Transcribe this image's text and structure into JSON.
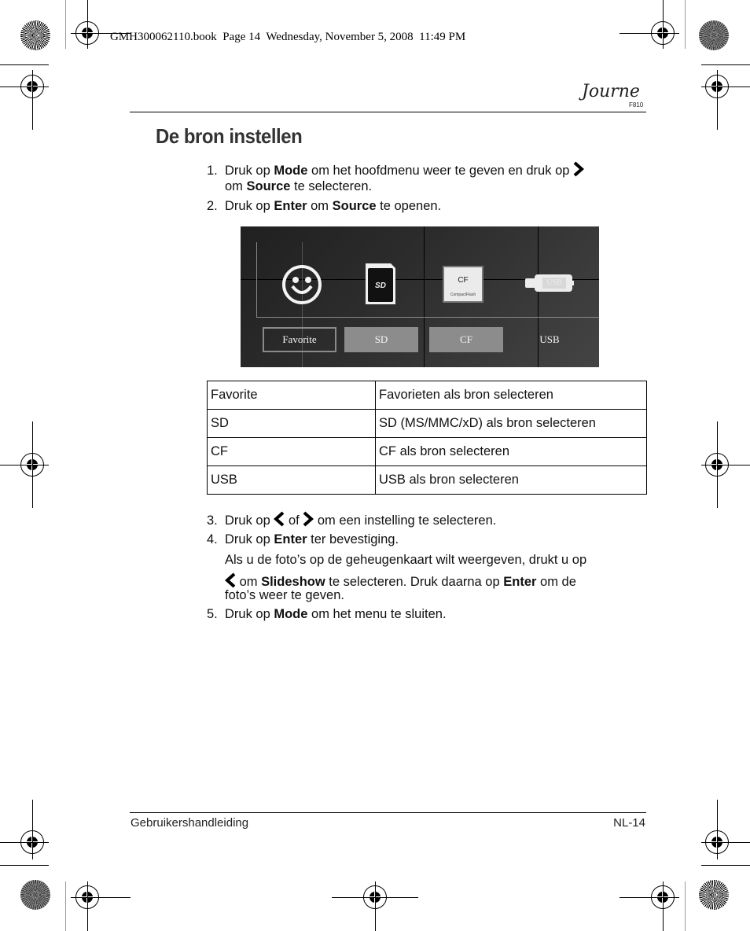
{
  "print_slug": "GMH300062110.book  Page 14  Wednesday, November 5, 2008  11:49 PM",
  "header": {
    "logo_text": "Journe",
    "model": "F810"
  },
  "title": "De bron instellen",
  "steps": [
    {
      "num": "1.",
      "parts": [
        "Druk op ",
        "Mode",
        " om het hoofdmenu weer te geven en druk op "
      ],
      "cont_parts": [
        "om ",
        "Source",
        " te selecteren."
      ]
    },
    {
      "num": "2.",
      "parts": [
        "Druk op ",
        "Enter",
        " om ",
        "Source",
        " te openen."
      ]
    },
    {
      "num": "3.",
      "parts": [
        "Druk op ",
        " of ",
        " om een instelling te selecteren."
      ]
    },
    {
      "num": "4.",
      "parts": [
        "Druk op ",
        "Enter",
        " ter bevestiging."
      ],
      "note_line1": "Als u de foto’s op de geheugenkaart wilt weergeven, drukt u op",
      "note_line2_parts": [
        " om ",
        "Slideshow",
        " te selecteren. Druk daarna op ",
        "Enter",
        " om de"
      ],
      "note_line3": "foto’s weer te geven."
    },
    {
      "num": "5.",
      "parts": [
        "Druk op ",
        "Mode",
        " om het menu te sluiten."
      ]
    }
  ],
  "screen": {
    "icons": [
      "smiley-icon",
      "sd-card-icon",
      "cf-card-icon",
      "usb-drive-icon"
    ],
    "sd_card_label": "SD",
    "cf_card_label": "CF",
    "cf_card_sub": "CompactFlash",
    "usb_label": "USB",
    "tabs": [
      {
        "label": "Favorite",
        "state": "selected"
      },
      {
        "label": "SD",
        "state": "grey"
      },
      {
        "label": "CF",
        "state": "grey"
      },
      {
        "label": "USB",
        "state": "plain"
      }
    ]
  },
  "table": {
    "rows": [
      [
        "Favorite",
        "Favorieten als bron selecteren"
      ],
      [
        "SD",
        "SD (MS/MMC/xD) als bron selecteren"
      ],
      [
        "CF",
        "CF als bron selecteren"
      ],
      [
        "USB",
        "USB als bron selecteren"
      ]
    ]
  },
  "footer": {
    "left": "Gebruikershandleiding",
    "right": "NL-14"
  }
}
